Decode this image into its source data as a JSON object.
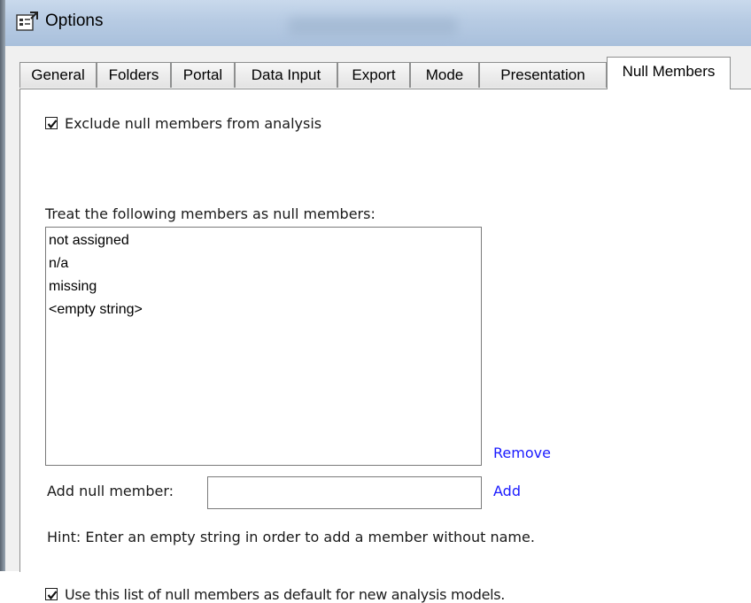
{
  "window": {
    "title": "Options"
  },
  "tabs": [
    {
      "label": "General"
    },
    {
      "label": "Folders"
    },
    {
      "label": "Portal"
    },
    {
      "label": "Data Input"
    },
    {
      "label": "Export"
    },
    {
      "label": "Mode"
    },
    {
      "label": "Presentation"
    },
    {
      "label": "Null Members",
      "active": true
    }
  ],
  "null_members": {
    "exclude_label": "Exclude null members from analysis",
    "exclude_checked": true,
    "list_label": "Treat the following members as null members:",
    "members": [
      "not assigned",
      "n/a",
      "missing",
      "<empty string>"
    ],
    "remove_label": "Remove",
    "add_label": "Add null member:",
    "add_value": "",
    "add_button_label": "Add",
    "hint": "Hint: Enter an empty string in order to add a member without name.",
    "default_label": "Use this list of null members as default for new analysis models.",
    "default_checked": true
  },
  "colors": {
    "link": "#1a1aff",
    "titlebar": "#b7cbe3",
    "dialog_bg": "#f0f0f0"
  },
  "icons": {
    "title": "options-properties-icon",
    "check": "checkmark-icon"
  }
}
